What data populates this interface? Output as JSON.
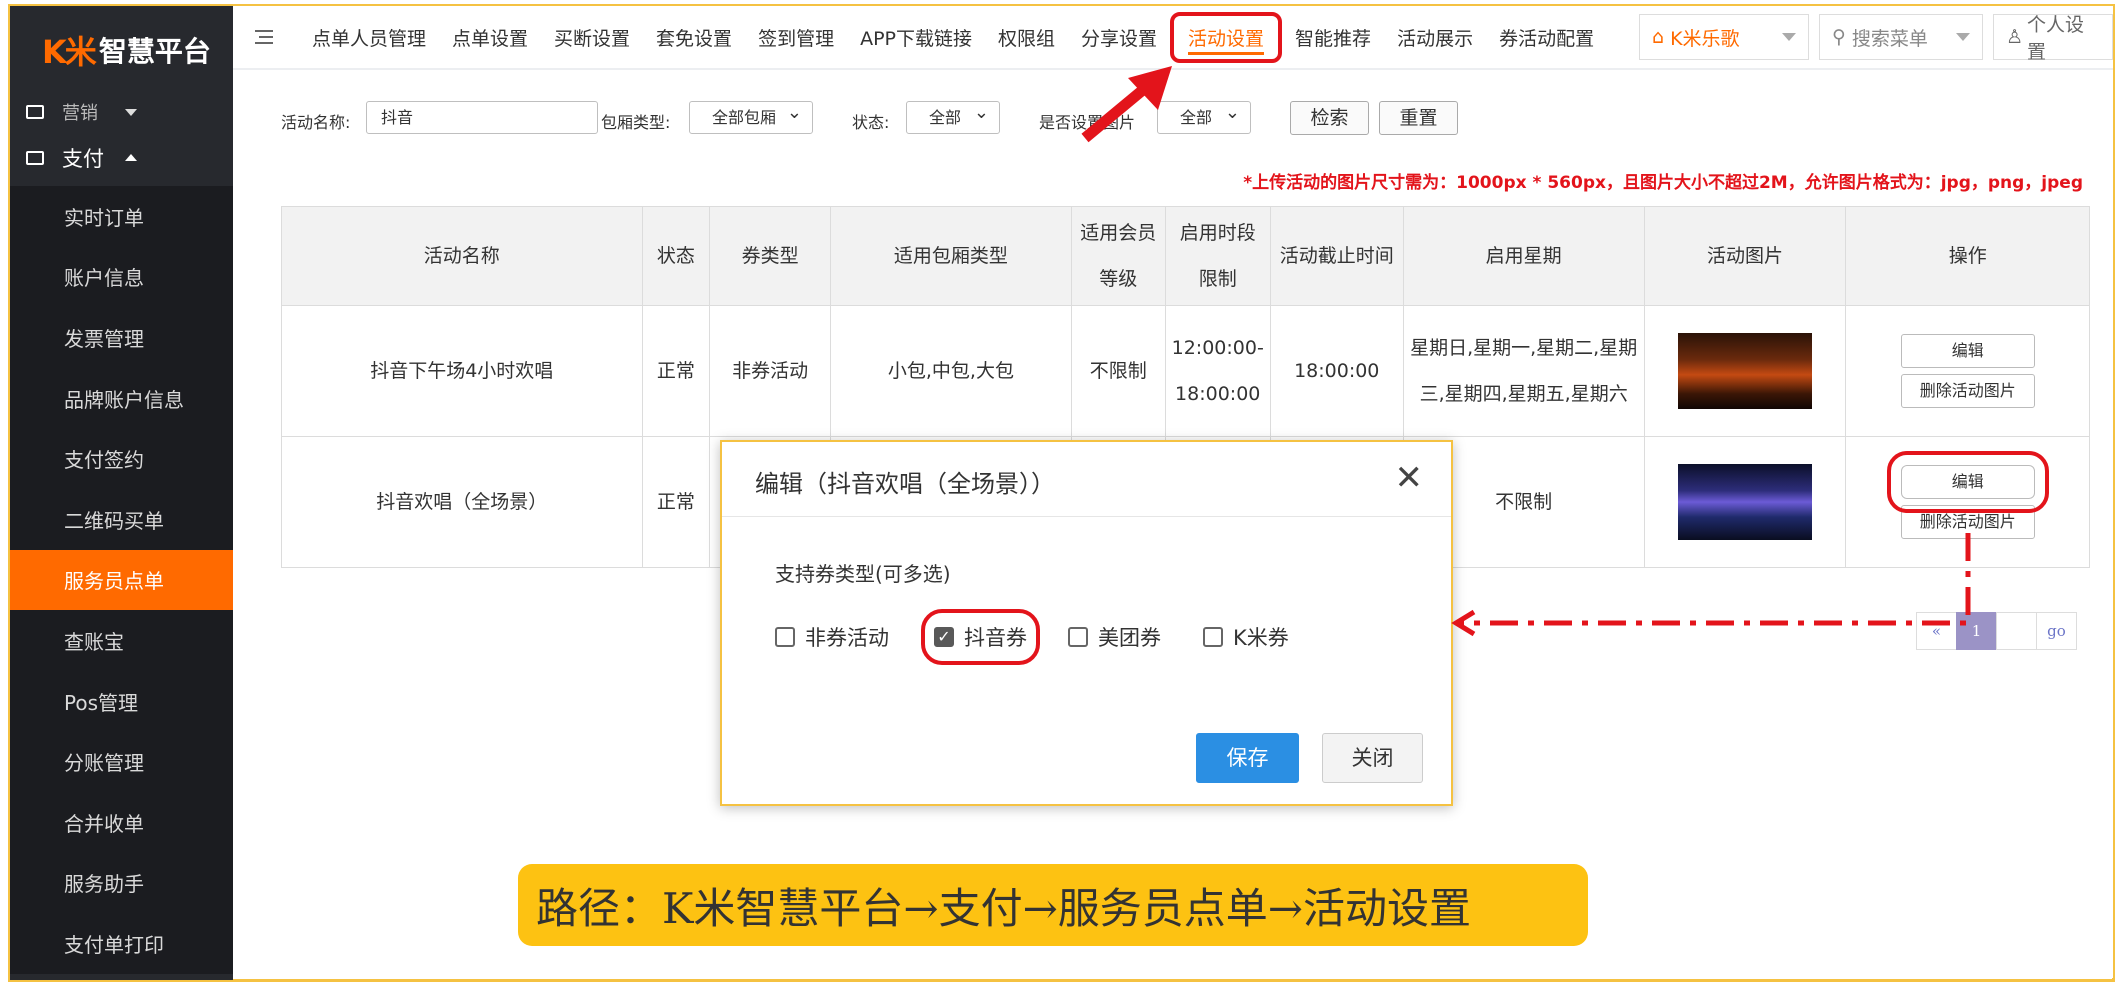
{
  "logo": {
    "mark": "K米",
    "text": "智慧平台"
  },
  "sidebar": {
    "group_marketing": "营销",
    "group_payment": "支付",
    "items": [
      "实时订单",
      "账户信息",
      "发票管理",
      "品牌账户信息",
      "支付签约",
      "二维码买单",
      "服务员点单",
      "查账宝",
      "Pos管理",
      "分账管理",
      "合并收单",
      "服务助手",
      "支付单打印"
    ]
  },
  "topnav": {
    "items": [
      "点单人员管理",
      "点单设置",
      "买断设置",
      "套免设置",
      "签到管理",
      "APP下载链接",
      "权限组",
      "分享设置",
      "活动设置",
      "智能推荐",
      "活动展示",
      "券活动配置"
    ],
    "store": "K米乐歌",
    "search_placeholder": "搜索菜单",
    "user": "个人设置"
  },
  "filter": {
    "name_label": "活动名称:",
    "name_value": "抖音",
    "room_label": "包厢类型:",
    "room_value": "全部包厢",
    "status_label": "状态:",
    "status_value": "全部",
    "image_label": "是否设置图片",
    "image_value": "全部",
    "search_btn": "检索",
    "reset_btn": "重置"
  },
  "notice": "*上传活动的图片尺寸需为：1000px * 560px，且图片大小不超过2M，允许图片格式为：jpg，png，jpeg",
  "table": {
    "headers": [
      "活动名称",
      "状态",
      "券类型",
      "适用包厢类型",
      "适用会员等级",
      "启用时段限制",
      "活动截止时间",
      "启用星期",
      "活动图片",
      "操作"
    ],
    "rows": [
      {
        "name": "抖音下午场4小时欢唱",
        "status": "正常",
        "coupon": "非券活动",
        "rooms": "小包,中包,大包",
        "member": "不限制",
        "period": "12:00:00-18:00:00",
        "deadline": "18:00:00",
        "weekdays": "星期日,星期一,星期二,星期三,星期四,星期五,星期六",
        "edit": "编辑",
        "delete_img": "删除活动图片"
      },
      {
        "name": "抖音欢唱（全场景）",
        "status": "正常",
        "weekdays": "不限制",
        "edit": "编辑",
        "delete_img": "删除活动图片"
      }
    ]
  },
  "pager": {
    "prev": "«",
    "current": "1",
    "go": "go"
  },
  "modal": {
    "title": "编辑（抖音欢唱（全场景））",
    "close_glyph": "✕",
    "label": "支持券类型(可多选)",
    "options": [
      {
        "label": "非券活动",
        "checked": false
      },
      {
        "label": "抖音券",
        "checked": true
      },
      {
        "label": "美团券",
        "checked": false
      },
      {
        "label": "K米券",
        "checked": false
      }
    ],
    "save": "保存",
    "close": "关闭"
  },
  "path_banner": "路径：K米智慧平台→支付→服务员点单→活动设置",
  "colors": {
    "accent": "#ff6a00",
    "annotation_red": "#e3141b",
    "banner": "#fdc212",
    "sidebar": "#27292e",
    "save": "#2b8fe3"
  }
}
